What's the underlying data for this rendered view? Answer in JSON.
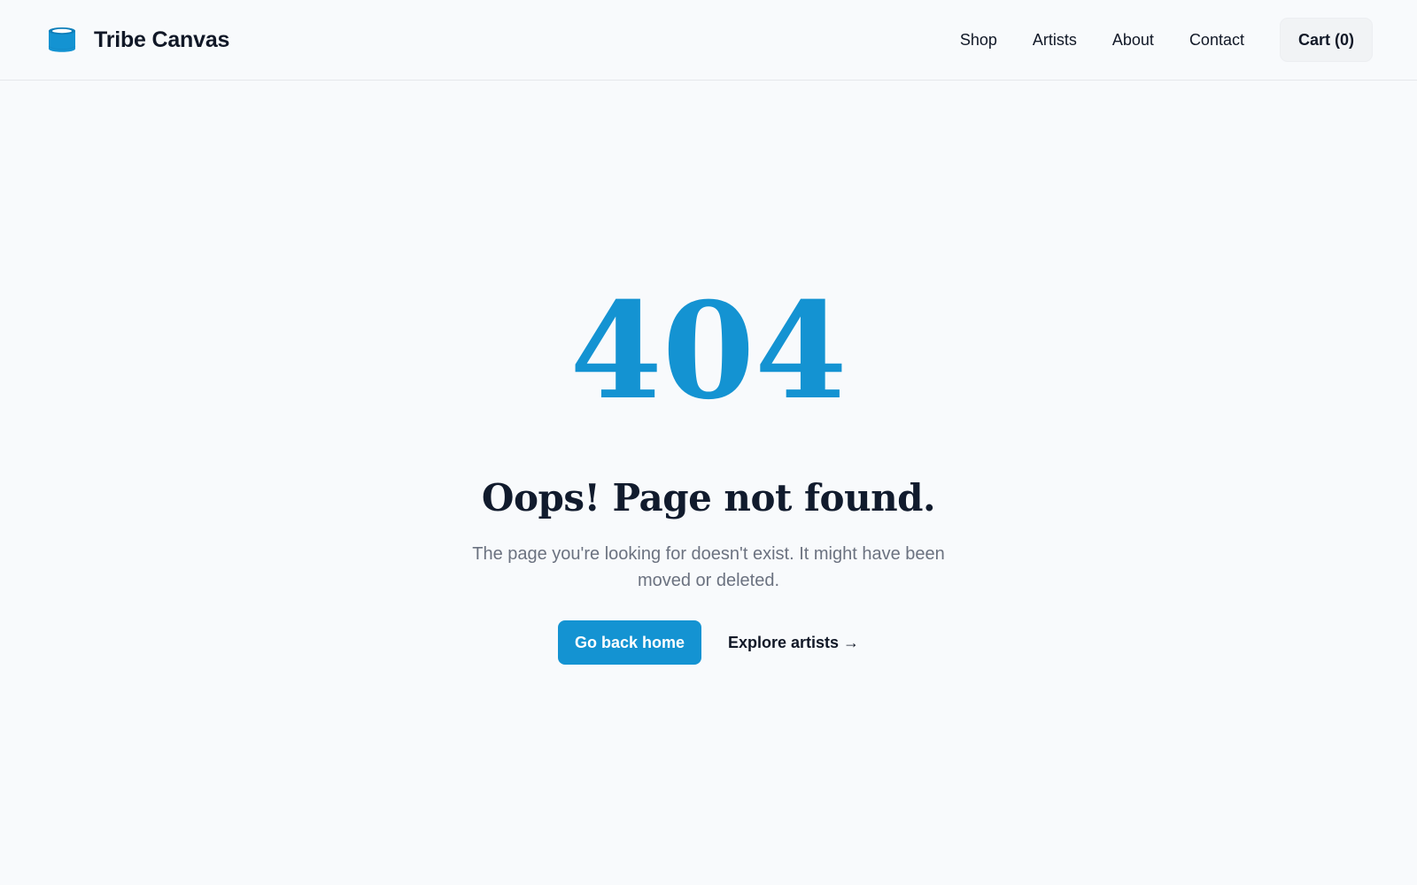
{
  "colors": {
    "accent": "#1493d2",
    "heading": "#111b2d",
    "body_text": "#6b7280",
    "background": "#f8fafc"
  },
  "header": {
    "brand": {
      "icon": "cylinder-logo-icon",
      "name": "Tribe Canvas"
    },
    "nav": {
      "shop": "Shop",
      "artists": "Artists",
      "about": "About",
      "contact": "Contact"
    },
    "cart_label": "Cart (0)"
  },
  "error": {
    "code": "404",
    "title": "Oops! Page not found.",
    "description": "The page you're looking for doesn't exist. It might have been moved or deleted."
  },
  "actions": {
    "home_button": "Go back home",
    "explore_link": "Explore artists →"
  }
}
